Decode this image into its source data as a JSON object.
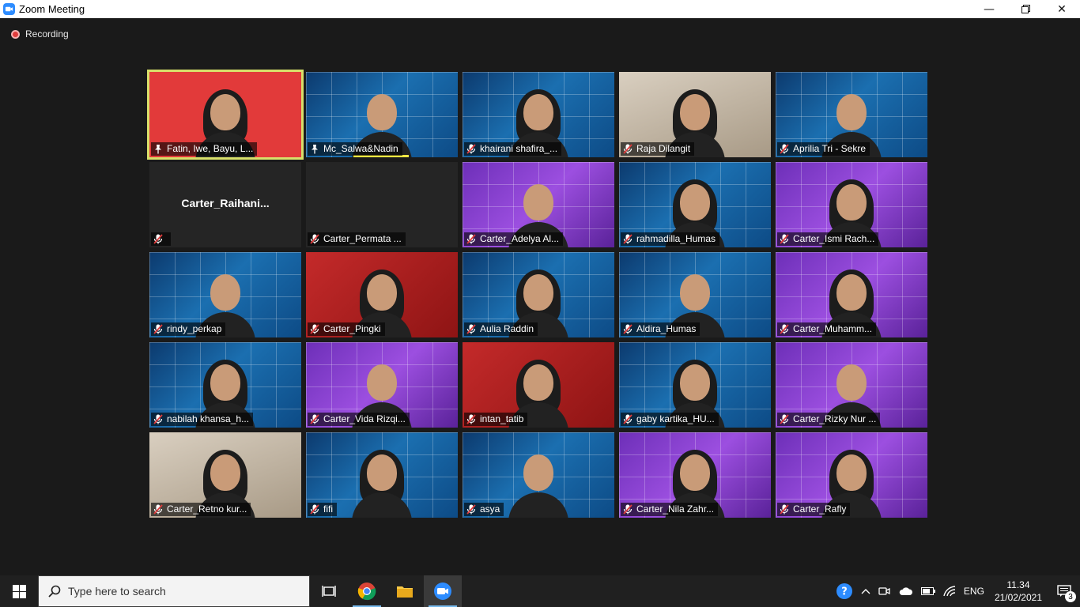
{
  "window": {
    "title": "Zoom Meeting",
    "minimize_icon": "minimize-icon",
    "maximize_icon": "restore-icon",
    "close_icon": "close-icon"
  },
  "meeting": {
    "recording_label": "Recording"
  },
  "participants": [
    {
      "name": "Fatin, Iwe, Bayu, L...",
      "muted": false,
      "bg": "redwall",
      "active": true
    },
    {
      "name": "Mc_Salwa&Nadin",
      "muted": false,
      "bg": "blue",
      "speaker": true
    },
    {
      "name": "khairani shafira_...",
      "muted": true,
      "bg": "blue"
    },
    {
      "name": "Raja Dilangit",
      "muted": true,
      "bg": "room"
    },
    {
      "name": "Aprilia Tri - Sekre",
      "muted": true,
      "bg": "blue"
    },
    {
      "name": "",
      "center_name": "Carter_Raihani...",
      "muted": true,
      "bg": "dark",
      "video_off": true
    },
    {
      "name": "Carter_Permata ...",
      "muted": true,
      "bg": "dark",
      "video_off": true
    },
    {
      "name": "Carter_Adelya Al...",
      "muted": true,
      "bg": "purple"
    },
    {
      "name": "rahmadilla_Humas",
      "muted": true,
      "bg": "blue"
    },
    {
      "name": "Carter_Ismi Rach...",
      "muted": true,
      "bg": "purple"
    },
    {
      "name": "rindy_perkap",
      "muted": true,
      "bg": "blue"
    },
    {
      "name": "Carter_Pingki",
      "muted": true,
      "bg": "red"
    },
    {
      "name": "Aulia Raddin",
      "muted": true,
      "bg": "blue"
    },
    {
      "name": "Aldira_Humas",
      "muted": true,
      "bg": "blue"
    },
    {
      "name": "Carter_Muhamm...",
      "muted": true,
      "bg": "purple"
    },
    {
      "name": "nabilah khansa_h...",
      "muted": true,
      "bg": "blue"
    },
    {
      "name": "Carter_Vida Rizqi...",
      "muted": true,
      "bg": "purple"
    },
    {
      "name": "intan_tatib",
      "muted": true,
      "bg": "red"
    },
    {
      "name": "gaby kartika_HU...",
      "muted": true,
      "bg": "blue"
    },
    {
      "name": "Carter_Rizky Nur ...",
      "muted": true,
      "bg": "purple"
    },
    {
      "name": "Carter_Retno kur...",
      "muted": true,
      "bg": "room"
    },
    {
      "name": "fifi",
      "muted": true,
      "bg": "blue"
    },
    {
      "name": "asya",
      "muted": true,
      "bg": "blue"
    },
    {
      "name": "Carter_Nila Zahr...",
      "muted": true,
      "bg": "purple"
    },
    {
      "name": "Carter_Rafly",
      "muted": true,
      "bg": "purple"
    }
  ],
  "taskbar": {
    "start_icon": "windows-start-icon",
    "search_placeholder": "Type here to search",
    "apps": [
      "task-view-icon",
      "chrome-icon",
      "file-explorer-icon",
      "zoom-icon"
    ],
    "tray": {
      "language": "ENG",
      "time": "11.34",
      "date": "21/02/2021",
      "notification_count": "3"
    }
  },
  "colors": {
    "zoom_blue": "#2d8cff",
    "active_speaker_border": "#d8e06a",
    "mute_red": "#e03b3b",
    "taskbar": "#202020"
  }
}
